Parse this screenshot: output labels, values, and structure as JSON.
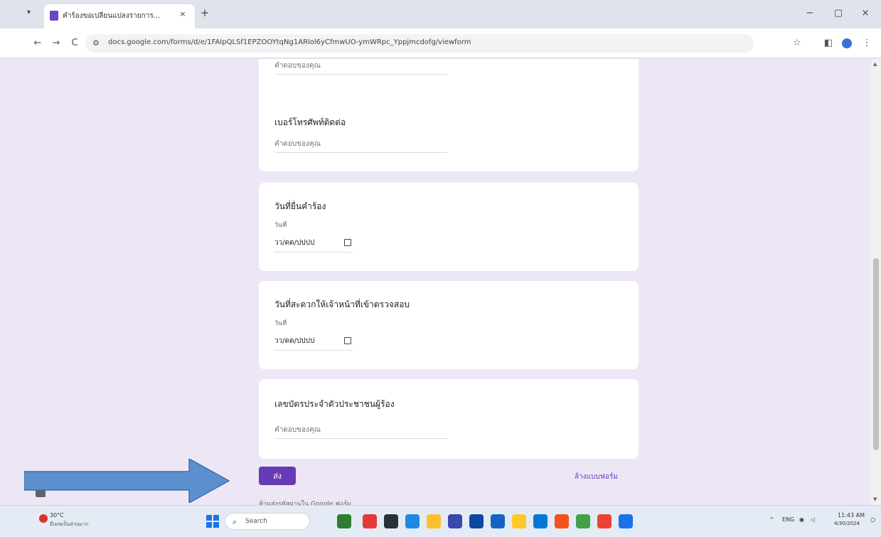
{
  "browser": {
    "tab_title": "คำร้องขอเปลี่ยนแปลงรายการ...",
    "tab_close": "×",
    "new_tab": "+",
    "minimize": "−",
    "maximize": "▢",
    "close": "×",
    "back": "←",
    "forward": "→",
    "reload": "C",
    "url": "docs.google.com/forms/d/e/1FAIpQLSf1EPZOOYtqNg1ARlol6yCfmwUO-ymWRpc_Yppjmcdofg/viewform",
    "star": "☆",
    "sidepanel": "◧",
    "menu": "⋮"
  },
  "form": {
    "top_card_input": "คำตอบของคุณ",
    "phone": {
      "title": "เบอร์โทรศัพท์ติดต่อ",
      "placeholder": "คำตอบของคุณ"
    },
    "submit_date": {
      "title": "วันที่ยื่นคำร้อง",
      "label": "วันที่",
      "value": "วว/ดด/ปปปป"
    },
    "inspect_date": {
      "title": "วันที่สะดวกให้เจ้าหน้าที่เข้าตรวจสอบ",
      "label": "วันที่",
      "value": "วว/ดด/ปปปป"
    },
    "id_card": {
      "title": "เลขบัตรประจำตัวประชาชนผู้ร้อง",
      "placeholder": "คำตอบของคุณ"
    },
    "submit_label": "ส่ง",
    "clear_label": "ล้างแบบฟอร์ม",
    "footer": "ห้ามส่งรหัสผ่านใน Google ฟอร์ม"
  },
  "taskbar": {
    "weather_temp": "30°C",
    "weather_desc": "มีเมฆเป็นส่วนมาก",
    "search_text": "Search",
    "tray_lang": "ENG",
    "clock_time": "11:43 AM",
    "clock_date": "4/30/2024"
  },
  "colors": {
    "accent": "#673ab7",
    "arrow": "#5b8fcf"
  }
}
